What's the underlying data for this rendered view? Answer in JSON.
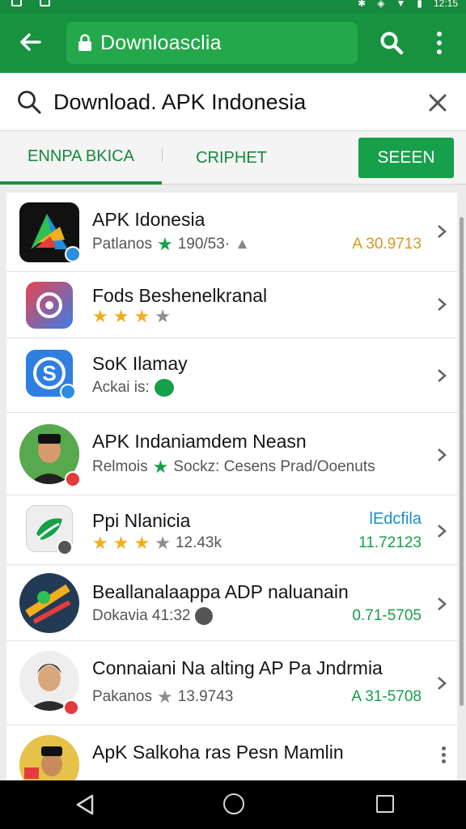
{
  "status_bar": {
    "time": "12:15"
  },
  "browser": {
    "url": "Downloasclia",
    "search_value": "Download. APK Indonesia",
    "search_placeholder": "Search"
  },
  "tabs": [
    {
      "label": "ENNPA BKICA"
    },
    {
      "label": "CRIPHET"
    },
    {
      "label": "SEEEN"
    }
  ],
  "apps": [
    {
      "title": "APK Idonesia",
      "subtitle": "Patlanos",
      "rating": "190/53·",
      "price": "A 30.9713",
      "price_color": "#d99a16"
    },
    {
      "title": "Fods Beshenelkranal",
      "subtitle": "",
      "rating": "",
      "price": ""
    },
    {
      "title": "SoK Ilamay",
      "subtitle": "Ackai is:",
      "rating": "",
      "price": ""
    },
    {
      "title": "APK Indaniamdem Neasn",
      "subtitle": "Relmois",
      "rating": "Sockz: Cesens Prad/Ooenuts",
      "price": ""
    },
    {
      "title": "Ppi Nlanicia",
      "subtitle": "",
      "rating": "12.43k",
      "price_top": "lEdcfila",
      "price": "11.72123"
    },
    {
      "title": "Beallanalaappa ADP naluanain",
      "subtitle": "Dokavia 41:32",
      "rating": "",
      "price": "0.71-5705"
    },
    {
      "title": "Connaiani Na alting AP Pa Jndrmia",
      "subtitle": "Pakanos",
      "rating": "13.9743",
      "price": "A 31-5708"
    },
    {
      "title": "ApK Salkoha ras Pesn Mamlin",
      "subtitle": "",
      "rating": "",
      "price": ""
    }
  ],
  "colors": {
    "primary": "#17933f",
    "accent_gold": "#f2ae1c",
    "accent_green": "#16a049"
  }
}
